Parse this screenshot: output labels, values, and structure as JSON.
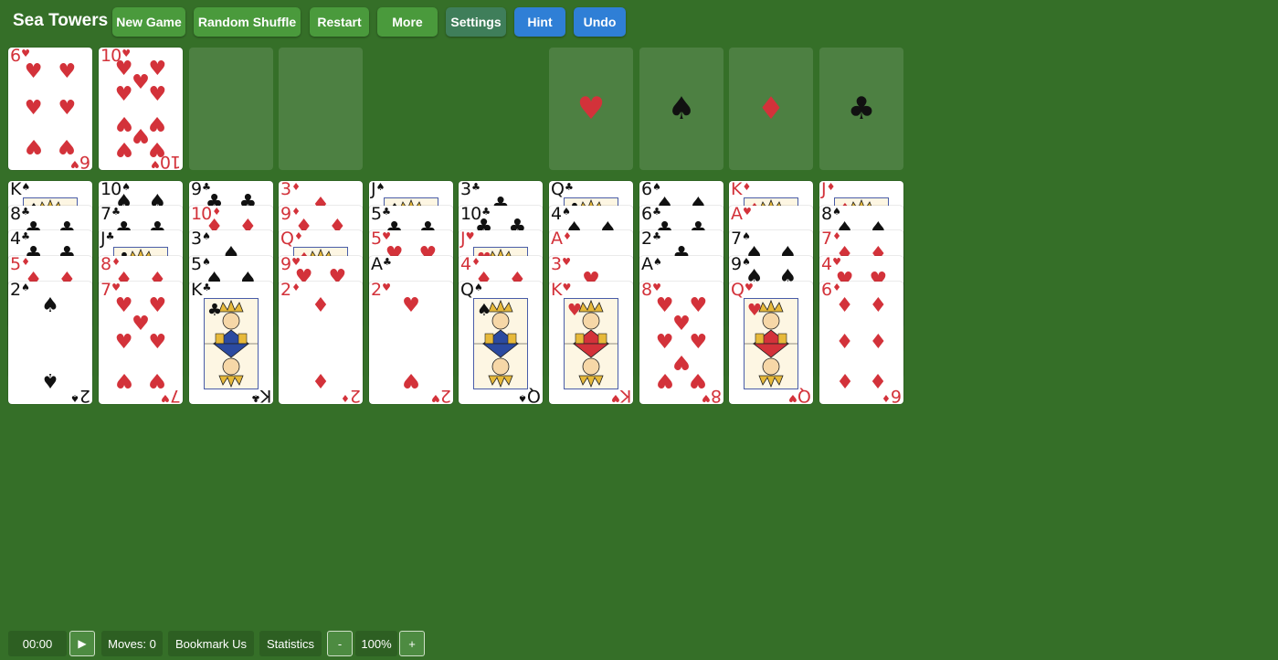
{
  "app": {
    "title": "Sea Towers"
  },
  "toolbar": {
    "buttons": [
      {
        "id": "new-game",
        "label": "New Game"
      },
      {
        "id": "random-shuffle",
        "label": "Random Shuffle"
      },
      {
        "id": "restart",
        "label": "Restart"
      },
      {
        "id": "more",
        "label": "More"
      },
      {
        "id": "settings",
        "label": "Settings"
      },
      {
        "id": "hint",
        "label": "Hint"
      },
      {
        "id": "undo",
        "label": "Undo"
      }
    ]
  },
  "colors": {
    "felt": "#356f28",
    "red_suit": "#d3323a",
    "black_suit": "#111111",
    "button_green": "#4a9a3c",
    "button_blue": "#2f7fd6"
  },
  "cells": [
    {
      "card": {
        "rank": "6",
        "suit": "hearts"
      }
    },
    {
      "card": {
        "rank": "10",
        "suit": "hearts"
      }
    },
    {
      "card": null
    },
    {
      "card": null
    }
  ],
  "foundations": [
    {
      "suit": "hearts",
      "glyph": "♥"
    },
    {
      "suit": "spades",
      "glyph": "♠"
    },
    {
      "suit": "diamonds",
      "glyph": "♦"
    },
    {
      "suit": "clubs",
      "glyph": "♣"
    }
  ],
  "tableau": [
    [
      {
        "rank": "K",
        "suit": "spades"
      },
      {
        "rank": "8",
        "suit": "clubs"
      },
      {
        "rank": "4",
        "suit": "clubs"
      },
      {
        "rank": "5",
        "suit": "diamonds"
      },
      {
        "rank": "2",
        "suit": "spades"
      }
    ],
    [
      {
        "rank": "10",
        "suit": "spades"
      },
      {
        "rank": "7",
        "suit": "clubs"
      },
      {
        "rank": "J",
        "suit": "clubs"
      },
      {
        "rank": "8",
        "suit": "diamonds"
      },
      {
        "rank": "7",
        "suit": "hearts"
      }
    ],
    [
      {
        "rank": "9",
        "suit": "clubs"
      },
      {
        "rank": "10",
        "suit": "diamonds"
      },
      {
        "rank": "3",
        "suit": "spades"
      },
      {
        "rank": "5",
        "suit": "spades"
      },
      {
        "rank": "K",
        "suit": "clubs"
      }
    ],
    [
      {
        "rank": "3",
        "suit": "diamonds"
      },
      {
        "rank": "9",
        "suit": "diamonds"
      },
      {
        "rank": "Q",
        "suit": "diamonds"
      },
      {
        "rank": "9",
        "suit": "hearts"
      },
      {
        "rank": "2",
        "suit": "diamonds"
      }
    ],
    [
      {
        "rank": "J",
        "suit": "spades"
      },
      {
        "rank": "5",
        "suit": "clubs"
      },
      {
        "rank": "5",
        "suit": "hearts"
      },
      {
        "rank": "A",
        "suit": "clubs"
      },
      {
        "rank": "2",
        "suit": "hearts"
      }
    ],
    [
      {
        "rank": "3",
        "suit": "clubs"
      },
      {
        "rank": "10",
        "suit": "clubs"
      },
      {
        "rank": "J",
        "suit": "hearts"
      },
      {
        "rank": "4",
        "suit": "diamonds"
      },
      {
        "rank": "Q",
        "suit": "spades"
      }
    ],
    [
      {
        "rank": "Q",
        "suit": "clubs"
      },
      {
        "rank": "4",
        "suit": "spades"
      },
      {
        "rank": "A",
        "suit": "diamonds"
      },
      {
        "rank": "3",
        "suit": "hearts"
      },
      {
        "rank": "K",
        "suit": "hearts"
      }
    ],
    [
      {
        "rank": "6",
        "suit": "spades"
      },
      {
        "rank": "6",
        "suit": "clubs"
      },
      {
        "rank": "2",
        "suit": "clubs"
      },
      {
        "rank": "A",
        "suit": "spades"
      },
      {
        "rank": "8",
        "suit": "hearts"
      }
    ],
    [
      {
        "rank": "K",
        "suit": "diamonds"
      },
      {
        "rank": "A",
        "suit": "hearts"
      },
      {
        "rank": "7",
        "suit": "spades"
      },
      {
        "rank": "9",
        "suit": "spades"
      },
      {
        "rank": "Q",
        "suit": "hearts"
      }
    ],
    [
      {
        "rank": "J",
        "suit": "diamonds"
      },
      {
        "rank": "8",
        "suit": "spades"
      },
      {
        "rank": "7",
        "suit": "diamonds"
      },
      {
        "rank": "4",
        "suit": "hearts"
      },
      {
        "rank": "6",
        "suit": "diamonds"
      }
    ]
  ],
  "status": {
    "timer": "00:00",
    "play_glyph": "▶",
    "moves": "Moves: 0",
    "bookmark": "Bookmark Us",
    "statistics": "Statistics",
    "zoom_out": "-",
    "zoom": "100%",
    "zoom_in": "+"
  }
}
